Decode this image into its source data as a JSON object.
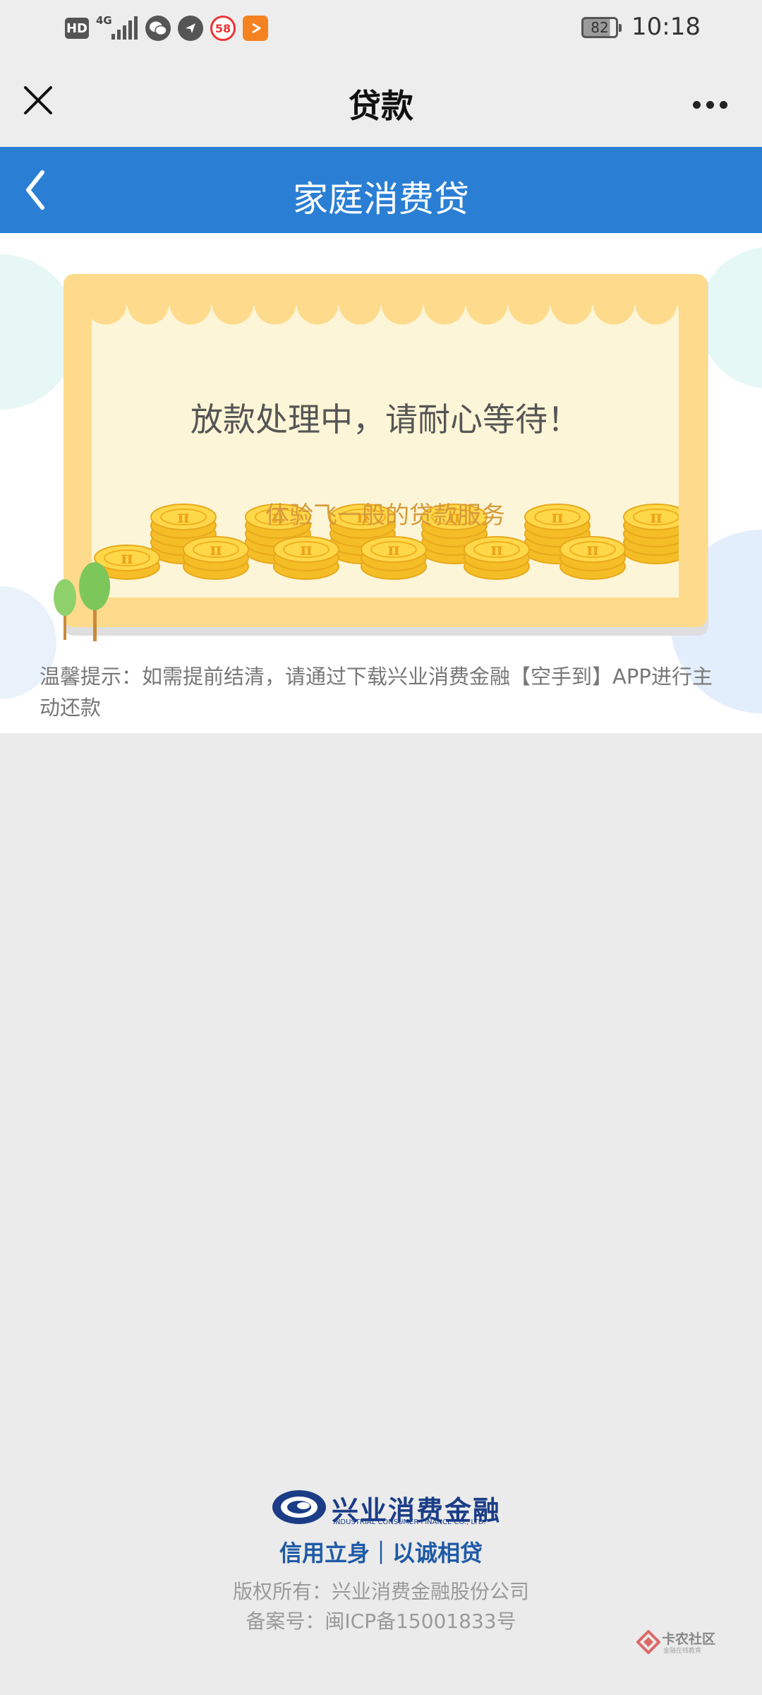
{
  "status_bar": {
    "hd_label": "HD",
    "network_label": "4G",
    "app_58_label": "58",
    "battery_level": "82",
    "time": "10:18"
  },
  "title_bar": {
    "title": "贷款",
    "close_icon": "close-icon",
    "more_icon": "more-icon"
  },
  "header": {
    "title": "家庭消费贷",
    "back_icon": "chevron-left-icon",
    "color": "#2a7fd4"
  },
  "card": {
    "status_message": "放款处理中，请耐心等待！",
    "slogan": "体验飞一般的贷款服务",
    "coin_symbol": "π"
  },
  "tip": {
    "text": "温馨提示：如需提前结清，请通过下载兴业消费金融【空手到】APP进行主动还款"
  },
  "footer": {
    "logo_name": "兴业消费金融",
    "logo_english": "INDUSTRIAL CONSUMER FINANCE CO., LTD.",
    "motto": "信用立身｜以诚相贷",
    "copyright": "版权所有：兴业消费金融股份公司",
    "icp": "备案号：闽ICP备15001833号",
    "brand_color": "#1b3d87"
  },
  "watermark": {
    "text": "卡农社区",
    "subtext": "金融在线教育"
  }
}
